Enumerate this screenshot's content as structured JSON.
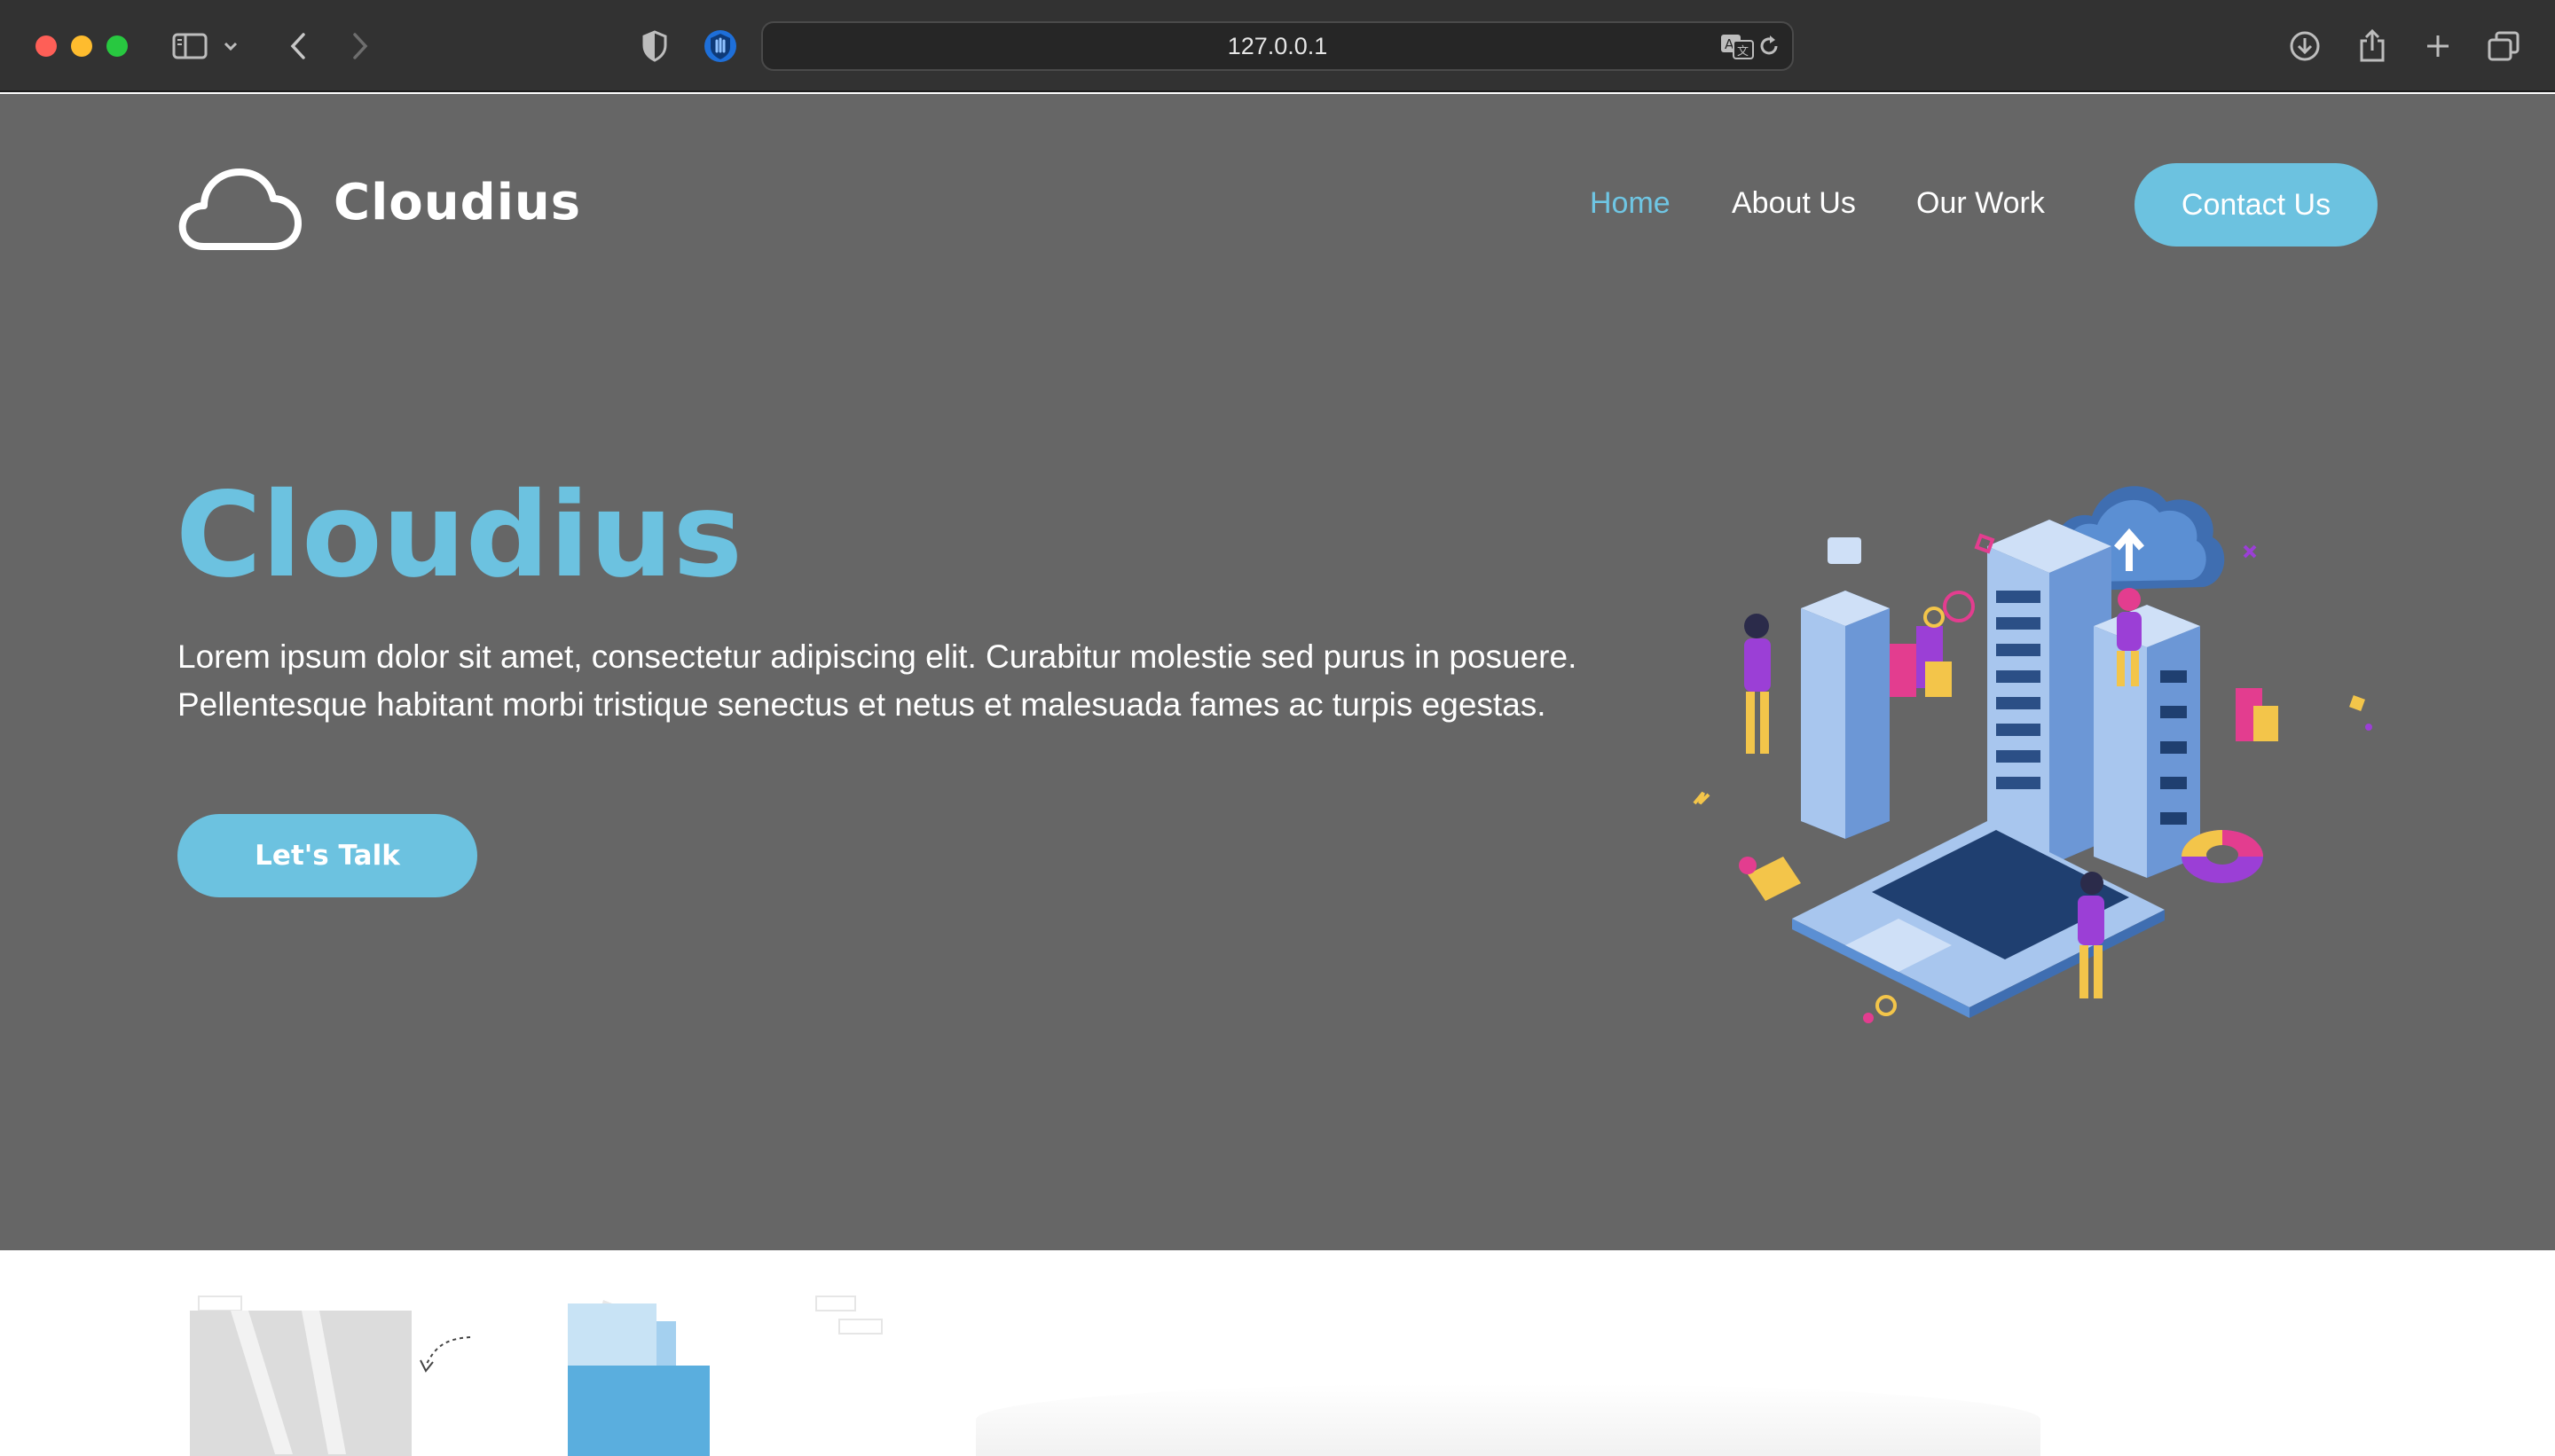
{
  "browser": {
    "url": "127.0.0.1",
    "icons": [
      "sidebar-icon",
      "chevron-down-icon",
      "back-icon",
      "forward-icon",
      "shield-icon",
      "extension-icon",
      "translate-icon",
      "reload-icon",
      "download-icon",
      "share-icon",
      "new-tab-icon",
      "tab-overview-icon"
    ]
  },
  "site": {
    "logo_text": "Cloudius",
    "logo_icon": "cloud-icon",
    "nav": {
      "home": "Home",
      "about": "About Us",
      "work": "Our Work",
      "contact": "Contact Us",
      "active": "Home"
    },
    "hero": {
      "title": "Cloudius",
      "text": "Lorem ipsum dolor sit amet, consectetur adipiscing elit. Curabitur molestie sed purus in posuere. Pellentesque habitant morbi tristique senectus et netus et malesuada fames ac turpis egestas.",
      "cta": "Let's Talk",
      "illustration": "cloud-server-illustration"
    }
  },
  "colors": {
    "accent": "#6cc2e0",
    "hero_bg": "#666666",
    "chrome_bg": "#323232",
    "text_light": "#ffffff"
  }
}
